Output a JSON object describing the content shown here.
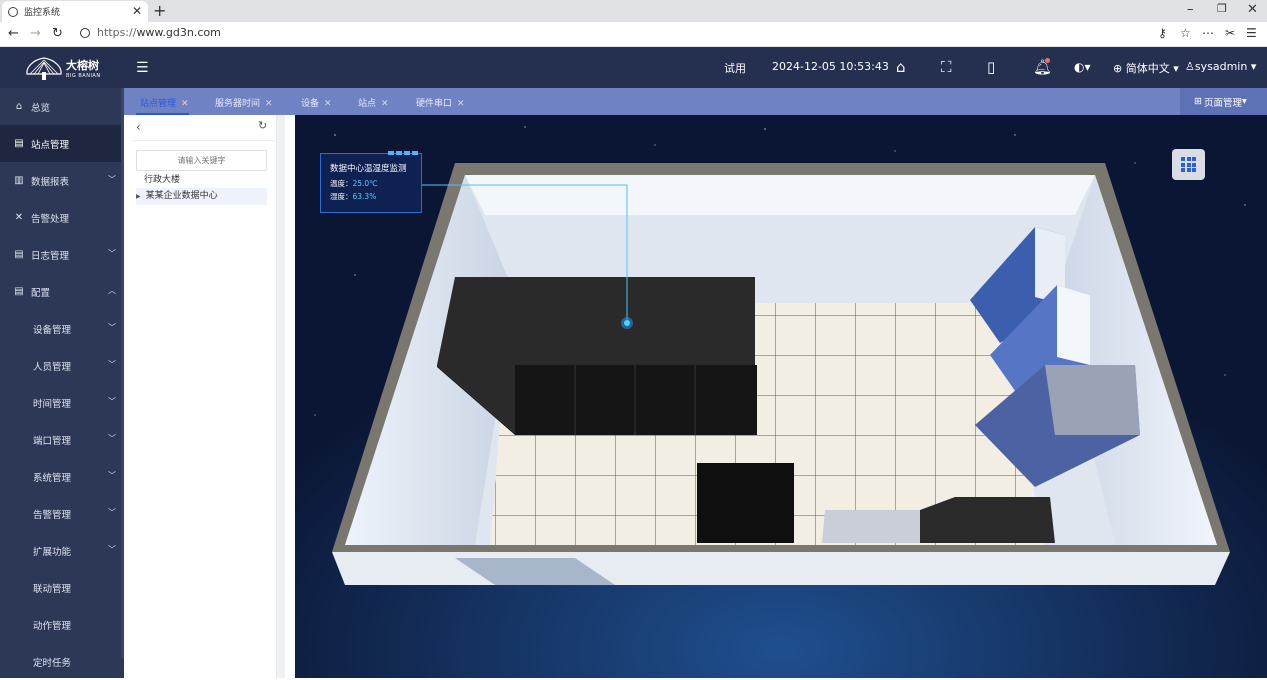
{
  "browser": {
    "tab_title": "监控系统",
    "url_scheme": "https://",
    "url_host": "www.gd3n.com"
  },
  "header": {
    "logo_text": "大榕树",
    "logo_subtext": "BIG BANIAN",
    "trial": "试用",
    "datetime": "2024-12-05 10:53:43",
    "language": "简体中文",
    "user": "sysadmin"
  },
  "sidebar": {
    "items": [
      {
        "label": "总览",
        "icon": "home-icon"
      },
      {
        "label": "站点管理",
        "icon": "site-icon"
      },
      {
        "label": "数据报表",
        "icon": "chart-icon"
      },
      {
        "label": "告警处理",
        "icon": "tools-icon"
      },
      {
        "label": "日志管理",
        "icon": "log-icon"
      },
      {
        "label": "配置",
        "icon": "config-icon"
      },
      {
        "label": "设备管理"
      },
      {
        "label": "人员管理"
      },
      {
        "label": "时间管理"
      },
      {
        "label": "端口管理"
      },
      {
        "label": "系统管理"
      },
      {
        "label": "告警管理"
      },
      {
        "label": "扩展功能"
      },
      {
        "label": "联动管理"
      },
      {
        "label": "动作管理"
      },
      {
        "label": "定时任务"
      }
    ]
  },
  "tabs": [
    {
      "label": "站点管理"
    },
    {
      "label": "服务器时间"
    },
    {
      "label": "设备"
    },
    {
      "label": "站点"
    },
    {
      "label": "硬件串口"
    }
  ],
  "page_manager": "页面管理",
  "tree": {
    "search_placeholder": "请输入关键字",
    "nodes": [
      {
        "label": "行政大楼"
      },
      {
        "label": "某某企业数据中心"
      }
    ]
  },
  "monitor": {
    "title": "数据中心温湿度监测",
    "temperature_label": "温度：",
    "temperature_value": "25.0℃",
    "humidity_label": "湿度：",
    "humidity_value": "63.3%"
  },
  "colors": {
    "header_bg": "#252f4f",
    "sidebar_bg": "#2d3856",
    "tabs_bg": "#6e82c4",
    "active_tab": "#2b59d6",
    "accent_value": "#4fd3ff"
  }
}
